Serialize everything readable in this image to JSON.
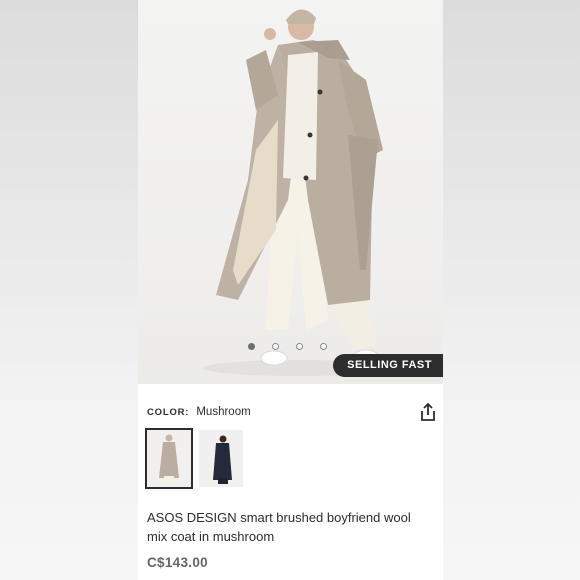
{
  "badge": {
    "label": "SELLING FAST"
  },
  "carousel": {
    "count": 4,
    "active": 0
  },
  "color": {
    "label": "COLOR:",
    "value": "Mushroom"
  },
  "share": {
    "icon": "share-icon"
  },
  "thumbnails": [
    {
      "alt": "mushroom",
      "selected": true
    },
    {
      "alt": "navy",
      "selected": false
    }
  ],
  "product": {
    "title": "ASOS DESIGN smart brushed boyfriend wool mix coat in mushroom",
    "price": "C$143.00"
  },
  "colors": {
    "accent": "#2d2d2d",
    "coat": "#b6aa9a",
    "price": "#666666"
  }
}
